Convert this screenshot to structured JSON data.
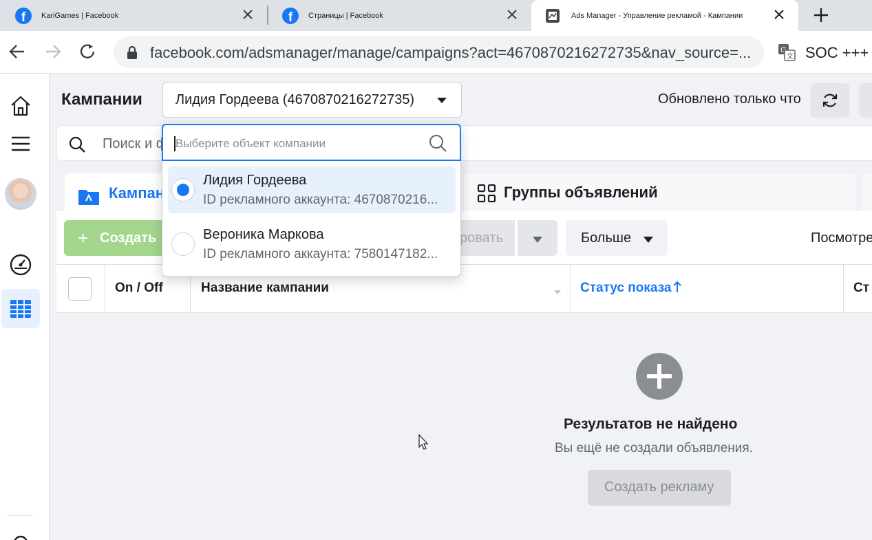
{
  "browser": {
    "tabs": [
      {
        "title": "KariGames | Facebook"
      },
      {
        "title": "Страницы | Facebook"
      },
      {
        "title": "Ads Manager - Управление рекламой - Кампании"
      }
    ],
    "url": "facebook.com/adsmanager/manage/campaigns?act=4670870216272735&nav_source=...",
    "extension_label": "SOC +++"
  },
  "header": {
    "title": "Кампании",
    "account_selector": "Лидия Гордеева (4670870216272735)",
    "updated": "Обновлено только что"
  },
  "search": {
    "placeholder": "Поиск и ф"
  },
  "tabs": {
    "campaigns": "Кампан",
    "adsets": "Группы объявлений"
  },
  "toolbar": {
    "create": "Создать",
    "edit": "ровать",
    "more": "Больше",
    "view": "Посмотре"
  },
  "table": {
    "columns": [
      "On / Off",
      "Название кампании",
      "Статус показа",
      "Ст"
    ]
  },
  "empty_state": {
    "title": "Результатов не найдено",
    "subtitle": "Вы ещё не создали объявления.",
    "button": "Создать рекламу"
  },
  "dropdown": {
    "placeholder": "Выберите объект компании",
    "options": [
      {
        "name": "Лидия Гордеева",
        "id": "ID рекламного аккаунта: 4670870216...",
        "selected": true
      },
      {
        "name": "Вероника Маркова",
        "id": "ID рекламного аккаунта: 7580147182...",
        "selected": false
      }
    ]
  },
  "colors": {
    "accent": "#1877f2",
    "create_button": "#a4d68e",
    "background": "#f0f2f5"
  }
}
